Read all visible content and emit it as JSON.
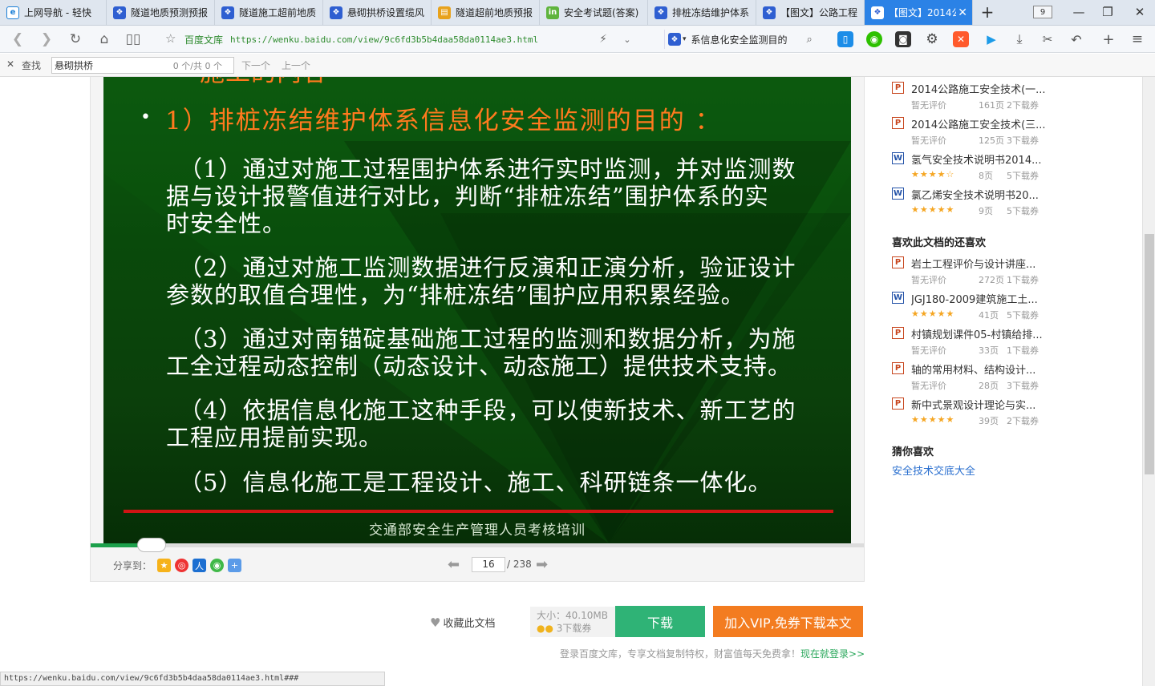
{
  "tabs": [
    {
      "title": "上网导航 - 轻快",
      "icon": "ie-icon"
    },
    {
      "title": "隧道地质预测预报",
      "icon": "baidu-paw-icon"
    },
    {
      "title": "隧道施工超前地质",
      "icon": "baidu-paw-icon"
    },
    {
      "title": "悬砌拱桥设置缆风",
      "icon": "baidu-paw-icon"
    },
    {
      "title": "隧道超前地质预报",
      "icon": "folder-icon"
    },
    {
      "title": "安全考试题(答案)",
      "icon": "green-circle-icon"
    },
    {
      "title": "排桩冻结维护体系",
      "icon": "baidu-paw-icon"
    },
    {
      "title": "【图文】公路工程",
      "icon": "baidu-paw-icon"
    },
    {
      "title": "【图文】2014公",
      "icon": "baidu-paw-icon",
      "active": true
    }
  ],
  "tab_count": "9",
  "address": {
    "site_name": "百度文库",
    "url": "https://wenku.baidu.com/view/9c6fd3b5b4daa58da0114ae3.html"
  },
  "search": {
    "text": "系信息化安全监测目的"
  },
  "find": {
    "label": "查找",
    "query": "悬砌拱桥",
    "count": "0 个/共 0 个",
    "next": "下一个",
    "prev": "上一个"
  },
  "slide": {
    "heading": "1）排桩冻结维护体系信息化安全监测的目的 ：",
    "items": [
      {
        "lines": [
          "（1）通过对施工过程围护体系进行实时监测，并对监测数",
          "据与设计报警值进行对比，判断“排桩冻结”围护体系的实",
          "时安全性。"
        ]
      },
      {
        "lines": [
          "（2）通过对施工监测数据进行反演和正演分析，验证设计",
          "参数的取值合理性，为“排桩冻结”围护应用积累经验。"
        ]
      },
      {
        "lines": [
          "（3）通过对南锚碇基础施工过程的监测和数据分析，为施",
          "工全过程动态控制（动态设计、动态施工）提供技术支持。"
        ]
      },
      {
        "lines": [
          "（4）依据信息化施工这种手段，可以使新技术、新工艺的",
          "工程应用提前实现。"
        ]
      },
      {
        "lines": [
          "（5）信息化施工是工程设计、施工、科研链条一体化。"
        ]
      }
    ],
    "footer": "交通部安全生产管理人员考核培训"
  },
  "viewer": {
    "share_label": "分享到：",
    "current_page": "16",
    "total_pages": "/ 238",
    "progress_fraction": 0.067
  },
  "actions": {
    "favorite": "收藏此文档",
    "size": "大小：40.10MB",
    "coupons": "3下载券",
    "download": "下载",
    "vip": "加入VIP,免券下载本文",
    "login_tip": "登录百度文库，专享文档复制特权，财富值每天免费拿！",
    "login_link": "现在就登录>>"
  },
  "sidebar": {
    "related": [
      {
        "type": "P",
        "title": "2014公路施工安全技术(一...",
        "rating": "暂无评价",
        "pages": "161页",
        "coupons": "2下载券"
      },
      {
        "type": "P",
        "title": "2014公路施工安全技术(三...",
        "rating": "暂无评价",
        "pages": "125页",
        "coupons": "3下载券"
      },
      {
        "type": "W",
        "title": "氢气安全技术说明书2014...",
        "rating": "★★★★☆",
        "pages": "8页",
        "coupons": "5下载券"
      },
      {
        "type": "W",
        "title": "氯乙烯安全技术说明书20...",
        "rating": "★★★★★",
        "pages": "9页",
        "coupons": "5下载券"
      }
    ],
    "also_like_heading": "喜欢此文档的还喜欢",
    "also_like": [
      {
        "type": "P",
        "title": "岩土工程评价与设计讲座...",
        "rating": "暂无评价",
        "pages": "272页",
        "coupons": "1下载券"
      },
      {
        "type": "W",
        "title": "JGJ180-2009建筑施工土...",
        "rating": "★★★★★",
        "pages": "41页",
        "coupons": "5下载券"
      },
      {
        "type": "P",
        "title": "村镇规划课件05-村镇给排...",
        "rating": "暂无评价",
        "pages": "33页",
        "coupons": "1下载券"
      },
      {
        "type": "P",
        "title": "轴的常用材料、结构设计...",
        "rating": "暂无评价",
        "pages": "28页",
        "coupons": "3下载券"
      },
      {
        "type": "P",
        "title": "新中式景观设计理论与实...",
        "rating": "★★★★★",
        "pages": "39页",
        "coupons": "2下载券"
      }
    ],
    "guess_heading": "猜你喜欢",
    "guess_link": "安全技术交底大全"
  },
  "status_url": "https://wenku.baidu.com/view/9c6fd3b5b4daa58da0114ae3.html###",
  "colors": {
    "accent": "#2b82e6",
    "slide_green": "#0b4a0c",
    "heading_orange": "#ff7a1e",
    "download_green": "#2fb376",
    "vip_orange": "#f37c20"
  }
}
